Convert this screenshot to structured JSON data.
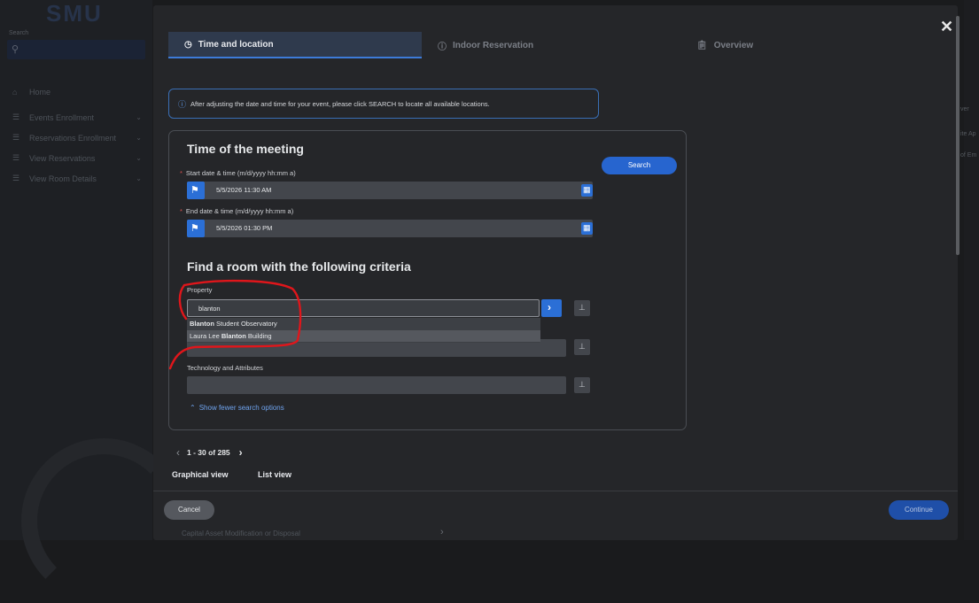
{
  "background": {
    "logo": "SMU",
    "search_label": "Search",
    "nav": [
      {
        "label": "Home",
        "icon": "home-icon"
      },
      {
        "label": "Events Enrollment",
        "icon": "list-icon"
      },
      {
        "label": "Reservations Enrollment",
        "icon": "list-icon"
      },
      {
        "label": "View Reservations",
        "icon": "list-icon"
      },
      {
        "label": "View Room Details",
        "icon": "list-icon"
      }
    ],
    "right_fragments": [
      "ver",
      "ite Ap",
      "of Em"
    ],
    "bottom_text": "Capital Asset Modification or Disposal"
  },
  "steps": [
    {
      "label": "Time and location",
      "icon": "clock-icon",
      "active": true
    },
    {
      "label": "Indoor Reservation",
      "icon": "info-icon",
      "active": false
    },
    {
      "label": "Overview",
      "icon": "clipboard-icon",
      "active": false
    }
  ],
  "info_banner": "After adjusting the date and time for your event, please click SEARCH to locate all available locations.",
  "meeting": {
    "title": "Time of the meeting",
    "start_label": "Start date & time (m/d/yyyy hh:mm a)",
    "start_value": "5/5/2026 11:30 AM",
    "end_label": "End date & time (m/d/yyyy hh:mm a)",
    "end_value": "5/5/2026 01:30 PM",
    "search_label": "Search"
  },
  "criteria": {
    "title": "Find a room with the following criteria",
    "property_label": "Property",
    "property_value": "blanton",
    "suggestions": [
      {
        "pre": "",
        "match": "Blanton",
        "post": " Student Observatory"
      },
      {
        "pre": "Laura Lee ",
        "match": "Blanton",
        "post": " Building"
      }
    ],
    "tech_label": "Technology and Attributes",
    "show_fewer": "Show fewer search options"
  },
  "pager": {
    "text": "1 - 30 of 285"
  },
  "views": {
    "graphical": "Graphical view",
    "list": "List view"
  },
  "footer": {
    "cancel": "Cancel",
    "continue": "Continue"
  },
  "colors": {
    "accent": "#2b6fd6",
    "annotation": "#e0161b"
  }
}
